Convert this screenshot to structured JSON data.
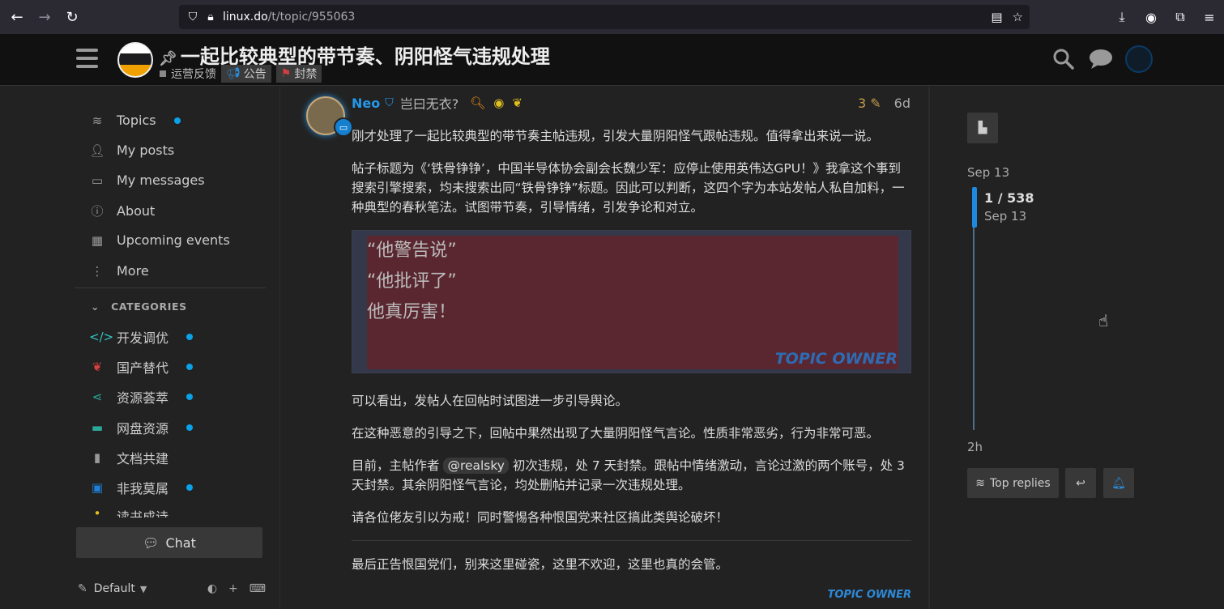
{
  "browser": {
    "url_host": "linux.do",
    "url_path": "/t/topic/955063"
  },
  "header": {
    "title": "一起比较典型的带节奏、阴阳怪气违规处理",
    "category": "运营反馈",
    "tags": [
      "公告",
      "封禁"
    ]
  },
  "sidebar": {
    "items": [
      {
        "label": "Topics",
        "icon": "layers-icon",
        "dot": true
      },
      {
        "label": "My posts",
        "icon": "user-icon",
        "dot": false
      },
      {
        "label": "My messages",
        "icon": "inbox-icon",
        "dot": false
      },
      {
        "label": "About",
        "icon": "info-icon",
        "dot": false
      },
      {
        "label": "Upcoming events",
        "icon": "calendar-icon",
        "dot": false
      },
      {
        "label": "More",
        "icon": "more-icon",
        "dot": false
      }
    ],
    "categories_heading": "CATEGORIES",
    "categories": [
      {
        "label": "开发调优",
        "color": "#32c3c3",
        "dot": true
      },
      {
        "label": "国产替代",
        "color": "#d94040",
        "dot": true
      },
      {
        "label": "资源荟萃",
        "color": "#2aa89a",
        "dot": true
      },
      {
        "label": "网盘资源",
        "color": "#2aa89a",
        "dot": true
      },
      {
        "label": "文档共建",
        "color": "#999999",
        "dot": false
      },
      {
        "label": "非我莫属",
        "color": "#1f7fd8",
        "dot": true
      },
      {
        "label": "读书成诗",
        "color": "#e8c020",
        "dot": false
      }
    ],
    "chat_label": "Chat",
    "theme_label": "Default"
  },
  "post": {
    "author": "Neo",
    "user_title": "岂曰无衣?",
    "edit_count": "3",
    "age": "6d",
    "p1": "刚才处理了一起比较典型的带节奏主帖违规，引发大量阴阳怪气跟帖违规。值得拿出来说一说。",
    "p2": "帖子标题为《‘铁骨铮铮’，中国半导体协会副会长魏少军：应停止使用英伟达GPU！》我拿这个事到搜索引擎搜索，均未搜索出同“铁骨铮铮”标题。因此可以判断，这四个字为本站发帖人私自加料，一种典型的春秋笔法。试图带节奏，引导情绪，引发争论和对立。",
    "quote_lines": [
      "“他警告说”",
      "“他批评了”",
      "他真厉害！"
    ],
    "quote_owner": "TOPIC OWNER",
    "p3": "可以看出，发帖人在回帖时试图进一步引导舆论。",
    "p4": "在这种恶意的引导之下，回帖中果然出现了大量阴阳怪气言论。性质非常恶劣，行为非常可恶。",
    "p5_a": "目前，主帖作者 ",
    "p5_mention": "@realsky",
    "p5_b": " 初次违规，处 7 天封禁。跟帖中情绪激动，言论过激的两个账号，处 3 天封禁。其余阴阳怪气言论，均处删帖并记录一次违规处理。",
    "p6": "请各位佬友引以为戒！同时警惕各种恨国党来社区搞此类舆论破坏！",
    "p7": "最后正告恨国党们，别来这里碰瓷，这里不欢迎，这里也真的会管。",
    "owner_tag": "TOPIC OWNER"
  },
  "timeline": {
    "start_date": "Sep 13",
    "position": "1 / 538",
    "position_date": "Sep 13",
    "end_label": "2h",
    "top_replies_label": "Top replies"
  }
}
